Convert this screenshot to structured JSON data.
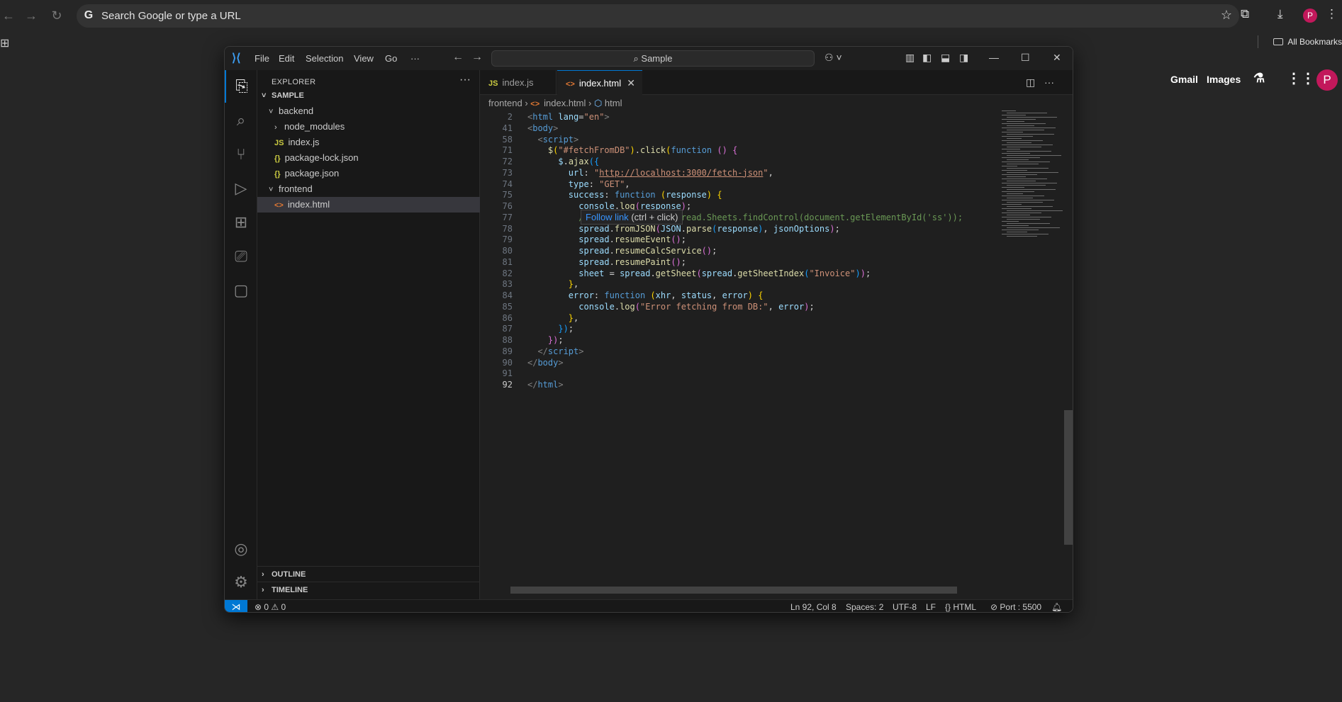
{
  "browser": {
    "omnibox_text": "Search Google or type a URL",
    "profile_initial": "P",
    "all_bookmarks": "All Bookmarks",
    "gmail": "Gmail",
    "images": "Images",
    "google_avatar": "P"
  },
  "vscode": {
    "menus": [
      "File",
      "Edit",
      "Selection",
      "View",
      "Go",
      "···"
    ],
    "search_placeholder": "Sample",
    "sidebar": {
      "title": "EXPLORER",
      "root": "SAMPLE",
      "tree": [
        {
          "label": "backend",
          "kind": "folder-open"
        },
        {
          "label": "node_modules",
          "kind": "folder"
        },
        {
          "label": "index.js",
          "kind": "js",
          "icon": "JS"
        },
        {
          "label": "package-lock.json",
          "kind": "json",
          "icon": "{}"
        },
        {
          "label": "package.json",
          "kind": "json",
          "icon": "{}"
        },
        {
          "label": "frontend",
          "kind": "folder-open"
        },
        {
          "label": "index.html",
          "kind": "html",
          "icon": "<>"
        }
      ],
      "outline": "OUTLINE",
      "timeline": "TIMELINE"
    },
    "tabs": [
      {
        "label": "index.js",
        "icon": "JS",
        "active": false
      },
      {
        "label": "index.html",
        "icon": "<>",
        "active": true
      }
    ],
    "breadcrumb": {
      "folder": "frontend",
      "file": "index.html",
      "symbol": "html"
    },
    "tooltip": {
      "link": "Follow link",
      "hint": "(ctrl + click)"
    },
    "code_lines": [
      {
        "n": "2",
        "html": "<span class=\"tag\">&lt;</span><span class=\"tname\">html</span> <span class=\"attr\">lang</span><span class=\"pn\">=</span><span class=\"str\">\"en\"</span><span class=\"tag\">&gt;</span>"
      },
      {
        "n": "41",
        "html": "<span class=\"tag\">&lt;</span><span class=\"tname\">body</span><span class=\"tag\">&gt;</span>"
      },
      {
        "n": "58",
        "html": "  <span class=\"tag\">&lt;</span><span class=\"tname\">script</span><span class=\"tag\">&gt;</span>"
      },
      {
        "n": "71",
        "html": "    <span class=\"fn\">$</span><span class=\"br1\">(</span><span class=\"str\">\"#fetchFromDB\"</span><span class=\"br1\">)</span><span class=\"pn\">.</span><span class=\"fn\">click</span><span class=\"br1\">(</span><span class=\"kw\">function</span> <span class=\"br2\">()</span> <span class=\"br2\">{</span>"
      },
      {
        "n": "72",
        "html": "      <span class=\"var\">$</span><span class=\"pn\">.</span><span class=\"fn\">ajax</span><span class=\"br3\">({</span>"
      },
      {
        "n": "73",
        "html": "        <span class=\"var\">url</span><span class=\"pn\">:</span> <span class=\"str\">\"<u>http://localhost:3000/fetch-json</u>\"</span><span class=\"pn\">,</span>"
      },
      {
        "n": "74",
        "html": "        <span class=\"var\">type</span><span class=\"pn\">:</span> <span class=\"str\">\"GET\"</span><span class=\"pn\">,</span>"
      },
      {
        "n": "75",
        "html": "        <span class=\"var\">success</span><span class=\"pn\">:</span> <span class=\"kw\">function</span> <span class=\"br1\">(</span><span class=\"var\">response</span><span class=\"br1\">)</span> <span class=\"br1\">{</span>"
      },
      {
        "n": "76",
        "html": "          <span class=\"var\">console</span><span class=\"pn\">.</span><span class=\"fn\">log</span><span class=\"br2\">(</span><span class=\"var\">response</span><span class=\"br2\">)</span><span class=\"pn\">;</span>"
      },
      {
        "n": "77",
        "html": "          <span class=\"cm\">//var spread = GC.Spread.Sheets.findControl(document.getElementById('ss'));</span>"
      },
      {
        "n": "78",
        "html": "          <span class=\"var\">spread</span><span class=\"pn\">.</span><span class=\"fn\">fromJSON</span><span class=\"br2\">(</span><span class=\"var\">JSON</span><span class=\"pn\">.</span><span class=\"fn\">parse</span><span class=\"br3\">(</span><span class=\"var\">response</span><span class=\"br3\">)</span><span class=\"pn\">,</span> <span class=\"var\">jsonOptions</span><span class=\"br2\">)</span><span class=\"pn\">;</span>"
      },
      {
        "n": "79",
        "html": "          <span class=\"var\">spread</span><span class=\"pn\">.</span><span class=\"fn\">resumeEvent</span><span class=\"br2\">()</span><span class=\"pn\">;</span>"
      },
      {
        "n": "80",
        "html": "          <span class=\"var\">spread</span><span class=\"pn\">.</span><span class=\"fn\">resumeCalcService</span><span class=\"br2\">()</span><span class=\"pn\">;</span>"
      },
      {
        "n": "81",
        "html": "          <span class=\"var\">spread</span><span class=\"pn\">.</span><span class=\"fn\">resumePaint</span><span class=\"br2\">()</span><span class=\"pn\">;</span>"
      },
      {
        "n": "82",
        "html": "          <span class=\"var\">sheet</span> <span class=\"pn\">=</span> <span class=\"var\">spread</span><span class=\"pn\">.</span><span class=\"fn\">getSheet</span><span class=\"br2\">(</span><span class=\"var\">spread</span><span class=\"pn\">.</span><span class=\"fn\">getSheetIndex</span><span class=\"br3\">(</span><span class=\"str\">\"Invoice\"</span><span class=\"br3\">)</span><span class=\"br2\">)</span><span class=\"pn\">;</span>"
      },
      {
        "n": "83",
        "html": "        <span class=\"br1\">}</span><span class=\"pn\">,</span>"
      },
      {
        "n": "84",
        "html": "        <span class=\"var\">error</span><span class=\"pn\">:</span> <span class=\"kw\">function</span> <span class=\"br1\">(</span><span class=\"var\">xhr</span><span class=\"pn\">,</span> <span class=\"var\">status</span><span class=\"pn\">,</span> <span class=\"var\">error</span><span class=\"br1\">)</span> <span class=\"br1\">{</span>"
      },
      {
        "n": "85",
        "html": "          <span class=\"var\">console</span><span class=\"pn\">.</span><span class=\"fn\">log</span><span class=\"br2\">(</span><span class=\"str\">\"Error fetching from DB:\"</span><span class=\"pn\">,</span> <span class=\"var\">error</span><span class=\"br2\">)</span><span class=\"pn\">;</span>"
      },
      {
        "n": "86",
        "html": "        <span class=\"br1\">}</span><span class=\"pn\">,</span>"
      },
      {
        "n": "87",
        "html": "      <span class=\"br3\">})</span><span class=\"pn\">;</span>"
      },
      {
        "n": "88",
        "html": "    <span class=\"br2\">})</span><span class=\"pn\">;</span>"
      },
      {
        "n": "89",
        "html": "  <span class=\"tag\">&lt;/</span><span class=\"tname\">script</span><span class=\"tag\">&gt;</span>"
      },
      {
        "n": "90",
        "html": "<span class=\"tag\">&lt;/</span><span class=\"tname\">body</span><span class=\"tag\">&gt;</span>"
      },
      {
        "n": "91",
        "html": ""
      },
      {
        "n": "92",
        "html": "<span class=\"tag\">&lt;/</span><span class=\"tname\">html</span><span class=\"tag\">&gt;</span>"
      }
    ],
    "status": {
      "errors": "0",
      "warnings": "0",
      "position": "Ln 92, Col 8",
      "spaces": "Spaces: 2",
      "encoding": "UTF-8",
      "eol": "LF",
      "language": "HTML",
      "port": "Port : 5500"
    }
  }
}
